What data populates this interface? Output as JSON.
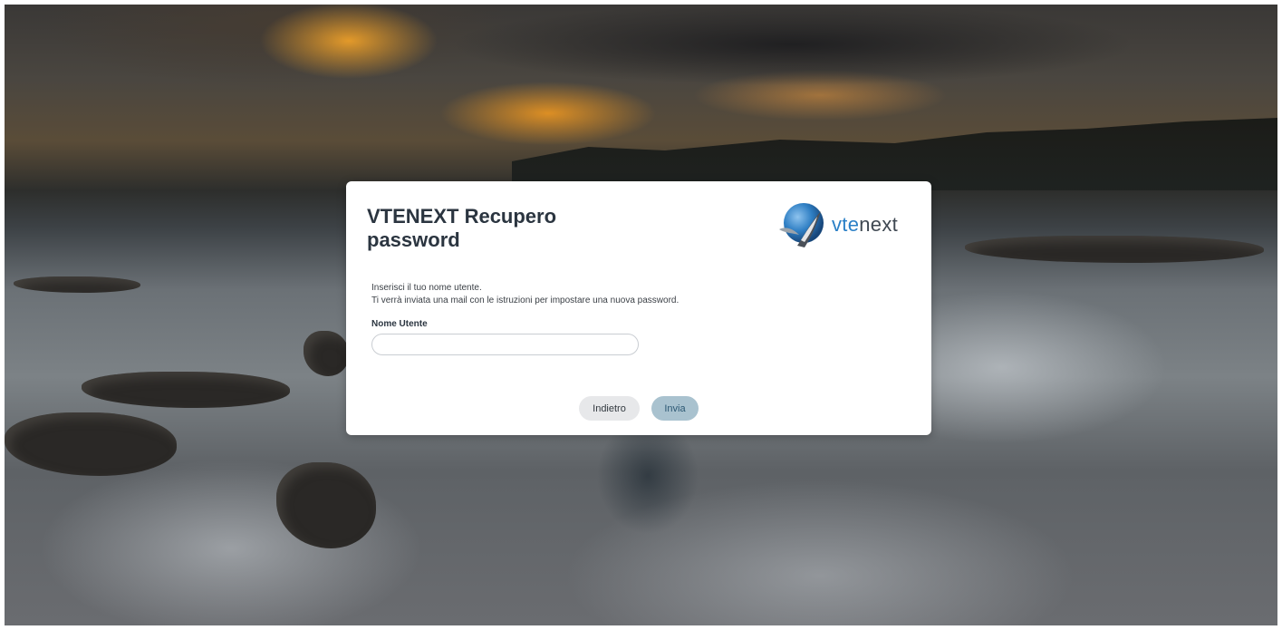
{
  "dialog": {
    "title": "VTENEXT Recupero password",
    "logo": {
      "icon": "vtenext-logo-icon",
      "text_accent": "vte",
      "text_rest": "next"
    },
    "instructions": [
      "Inserisci il tuo nome utente.",
      "Ti verrà inviata una mail con le istruzioni per impostare una nuova password."
    ],
    "username_field": {
      "label": "Nome Utente",
      "value": "",
      "placeholder": ""
    },
    "buttons": {
      "back_label": "Indietro",
      "send_label": "Invia"
    }
  },
  "colors": {
    "title": "#2b3540",
    "logo_accent": "#2a7fc6",
    "send_button_bg": "#a9c2cf",
    "back_button_bg": "#e7e8ea"
  }
}
